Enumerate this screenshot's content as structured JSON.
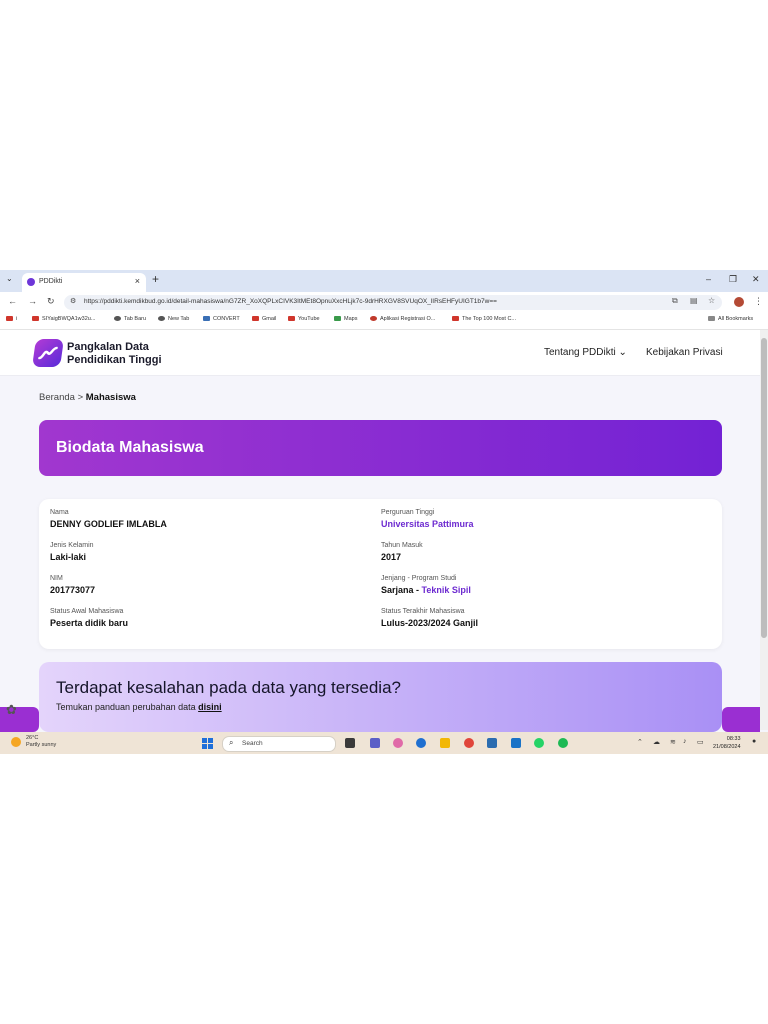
{
  "browser": {
    "tab_title": "PDDikti",
    "url": "https://pddikti.kemdikbud.go.id/detail-mahasiswa/nG7ZR_XoXQPLxCIVK3ItMEt8OpnuXxcHLjk7c-9drHRXGV8SVUqOX_lIRsEHFyUIGT1b7w==",
    "bookmarks": [
      {
        "label": "i",
        "color": "#d0362c"
      },
      {
        "label": "SIYaigBWQA1w32u...",
        "color": "#d0362c"
      },
      {
        "label": "Tab Baru",
        "color": "#555555"
      },
      {
        "label": "New Tab",
        "color": "#555555"
      },
      {
        "label": "CONVERT",
        "color": "#3a6fb5"
      },
      {
        "label": "Gmail",
        "color": "#d0362c"
      },
      {
        "label": "YouTube",
        "color": "#d0362c"
      },
      {
        "label": "Maps",
        "color": "#3a9a4a"
      },
      {
        "label": "Aplikasi Registrasi O...",
        "color": "#c0392b"
      },
      {
        "label": "The Top 100 Most C...",
        "color": "#d0362c"
      }
    ],
    "all_bookmarks": "All Bookmarks"
  },
  "site": {
    "brand_line1": "Pangkalan Data",
    "brand_line2": "Pendidikan Tinggi",
    "menu_about": "Tentang PDDikti",
    "menu_privacy": "Kebijakan Privasi"
  },
  "breadcrumb": {
    "home": "Beranda",
    "separator": ">",
    "current": "Mahasiswa"
  },
  "banner": {
    "title": "Biodata Mahasiswa"
  },
  "biodata": {
    "nama_label": "Nama",
    "nama": "DENNY GODLIEF IMLABLA",
    "jk_label": "Jenis Kelamin",
    "jk": "Laki-laki",
    "nim_label": "NIM",
    "nim": "201773077",
    "status_awal_label": "Status Awal Mahasiswa",
    "status_awal": "Peserta didik baru",
    "pt_label": "Perguruan Tinggi",
    "pt": "Universitas Pattimura",
    "tahun_label": "Tahun Masuk",
    "tahun": "2017",
    "jenjang_label": "Jenjang - Program Studi",
    "jenjang": "Sarjana",
    "jenjang_sep": " - ",
    "prodi": "Teknik Sipil",
    "status_akhir_label": "Status Terakhir Mahasiswa",
    "status_akhir": "Lulus-2023/2024 Ganjil"
  },
  "help": {
    "title": "Terdapat kesalahan pada data yang tersedia?",
    "sub": "Temukan panduan perubahan data",
    "link": "disini"
  },
  "taskbar": {
    "temp": "26°C",
    "weather": "Partly sunny",
    "search": "Search",
    "time": "08:33",
    "date": "21/08/2024"
  }
}
